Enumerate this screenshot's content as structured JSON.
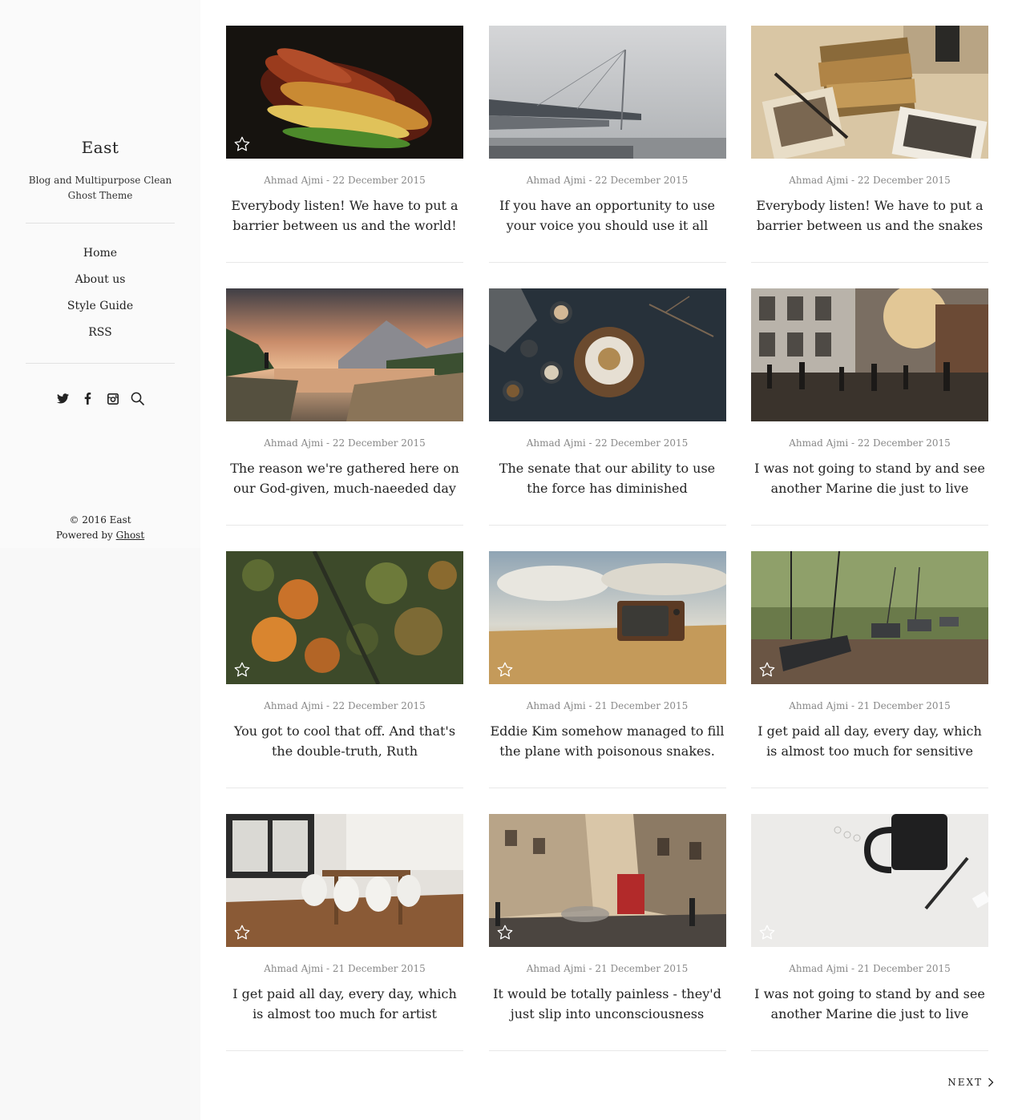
{
  "sidebar": {
    "site_title": "East",
    "site_description": "Blog and Multipurpose Clean Ghost Theme",
    "nav": [
      {
        "label": "Home"
      },
      {
        "label": "About us"
      },
      {
        "label": "Style Guide"
      },
      {
        "label": "RSS"
      }
    ],
    "social_icons": [
      "twitter-icon",
      "facebook-icon",
      "instagram-icon",
      "search-icon"
    ],
    "copyright": "© 2016 East",
    "powered_by": "Powered by",
    "powered_by_link": "Ghost"
  },
  "posts": [
    {
      "author": "Ahmad Ajmi",
      "date": "22 December 2015",
      "title": "Everybody listen! We have to put a barrier between us and the world!",
      "featured": true,
      "image": "autumn-leaves"
    },
    {
      "author": "Ahmad Ajmi",
      "date": "22 December 2015",
      "title": "If you have an opportunity to use your voice you should use it all",
      "featured": false,
      "image": "foggy-bridge"
    },
    {
      "author": "Ahmad Ajmi",
      "date": "22 December 2015",
      "title": "Everybody listen! We have to put a barrier between us and the snakes",
      "featured": false,
      "image": "old-photos-and-books"
    },
    {
      "author": "Ahmad Ajmi",
      "date": "22 December 2015",
      "title": "The reason we're gathered here on our God-given, much-naeeded day",
      "featured": false,
      "image": "mountain-lake-sunset"
    },
    {
      "author": "Ahmad Ajmi",
      "date": "22 December 2015",
      "title": "The senate that our ability to use the force has diminished",
      "featured": false,
      "image": "food-on-dark-table"
    },
    {
      "author": "Ahmad Ajmi",
      "date": "22 December 2015",
      "title": "I was not going to stand by and see another Marine die just to live",
      "featured": false,
      "image": "city-street-crowd"
    },
    {
      "author": "Ahmad Ajmi",
      "date": "22 December 2015",
      "title": "You got to cool that off. And that's the double-truth, Ruth",
      "featured": true,
      "image": "aerial-autumn-forest"
    },
    {
      "author": "Ahmad Ajmi",
      "date": "21 December 2015",
      "title": "Eddie Kim somehow managed to fill the plane with poisonous snakes.",
      "featured": true,
      "image": "old-tv-in-field"
    },
    {
      "author": "Ahmad Ajmi",
      "date": "21 December 2015",
      "title": "I get paid all day, every day, which is almost too much for sensitive",
      "featured": true,
      "image": "playground-swings"
    },
    {
      "author": "Ahmad Ajmi",
      "date": "21 December 2015",
      "title": "I get paid all day, every day, which is almost too much for artist",
      "featured": true,
      "image": "dining-room"
    },
    {
      "author": "Ahmad Ajmi",
      "date": "21 December 2015",
      "title": "It would be totally painless - they'd just slip into unconsciousness",
      "featured": true,
      "image": "london-street-bus"
    },
    {
      "author": "Ahmad Ajmi",
      "date": "21 December 2015",
      "title": "I was not going to stand by and see another Marine die just to live",
      "featured": true,
      "image": "mug-and-pen"
    }
  ],
  "pagination": {
    "next_label": "NEXT"
  },
  "colors": {
    "sidebar_bg": "#fafafa",
    "text": "#222222",
    "meta": "#888888",
    "divider": "#e2e2e2"
  }
}
